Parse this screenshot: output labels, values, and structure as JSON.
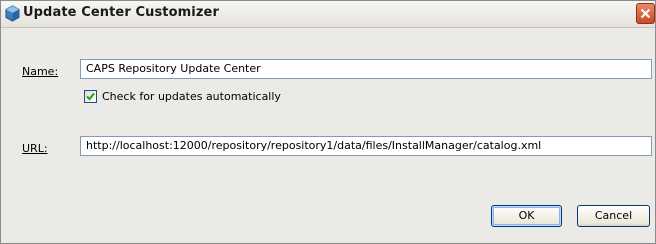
{
  "window": {
    "title": "Update Center Customizer"
  },
  "form": {
    "name_label": "Name:",
    "name_value": "CAPS Repository Update Center",
    "checkbox_label": "Check for updates automatically",
    "checkbox_checked": true,
    "url_label": "URL:",
    "url_value": "http://localhost:12000/repository/repository1/data/files/InstallManager/catalog.xml"
  },
  "buttons": {
    "ok_label": "OK",
    "cancel_label": "Cancel"
  },
  "colors": {
    "dialog_bg": "#eceae6",
    "field_border": "#7f9db9",
    "close_button": "#c74a23",
    "check_mark": "#21a121"
  }
}
